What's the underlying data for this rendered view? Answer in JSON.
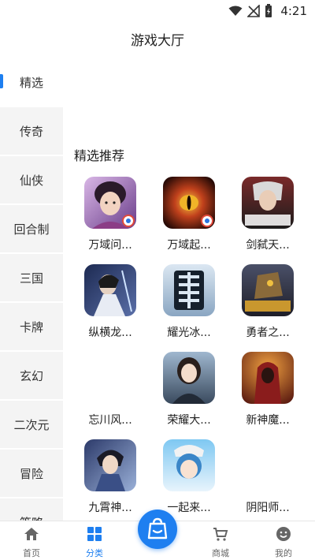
{
  "status_bar": {
    "time": "4:21",
    "icons": [
      "wifi-icon",
      "signal-icon",
      "battery-icon"
    ]
  },
  "header": {
    "title": "游戏大厅"
  },
  "sidebar": {
    "items": [
      {
        "label": "精选",
        "active": true
      },
      {
        "label": "传奇"
      },
      {
        "label": "仙侠"
      },
      {
        "label": "回合制"
      },
      {
        "label": "三国"
      },
      {
        "label": "卡牌"
      },
      {
        "label": "玄幻"
      },
      {
        "label": "二次元"
      },
      {
        "label": "冒险"
      },
      {
        "label": "策略"
      }
    ]
  },
  "main": {
    "section_title": "精选推荐",
    "games": [
      {
        "name": "万域问...",
        "icon": "game-icon-woman-warrior"
      },
      {
        "name": "万域起...",
        "icon": "game-icon-dragon-eye"
      },
      {
        "name": "剑弑天...",
        "icon": "game-icon-sword-hero"
      },
      {
        "name": "纵横龙...",
        "icon": "game-icon-swordsman"
      },
      {
        "name": "耀光冰...",
        "icon": "game-icon-dragon-character"
      },
      {
        "name": "勇者之...",
        "icon": "game-icon-mech-dragon"
      },
      {
        "name": "忘川风...",
        "icon": ""
      },
      {
        "name": "荣耀大...",
        "icon": "game-icon-actress"
      },
      {
        "name": "新神魔...",
        "icon": "game-icon-hooded-warrior"
      },
      {
        "name": "九霄神...",
        "icon": "game-icon-young-swordsman"
      },
      {
        "name": "一起来...",
        "icon": "game-icon-anime-girl"
      },
      {
        "name": "阴阳师...",
        "icon": ""
      }
    ]
  },
  "bottom_nav": {
    "items": [
      {
        "label": "首页",
        "icon": "home-icon"
      },
      {
        "label": "分类",
        "icon": "category-grid-icon",
        "active": true
      },
      {
        "label": "",
        "icon": "shopping-bag-icon"
      },
      {
        "label": "商城",
        "icon": "cart-icon"
      },
      {
        "label": "我的",
        "icon": "profile-icon"
      }
    ]
  },
  "colors": {
    "accent": "#1e7ff0",
    "sidebar_bg": "#f4f4f4",
    "text": "#222222"
  }
}
